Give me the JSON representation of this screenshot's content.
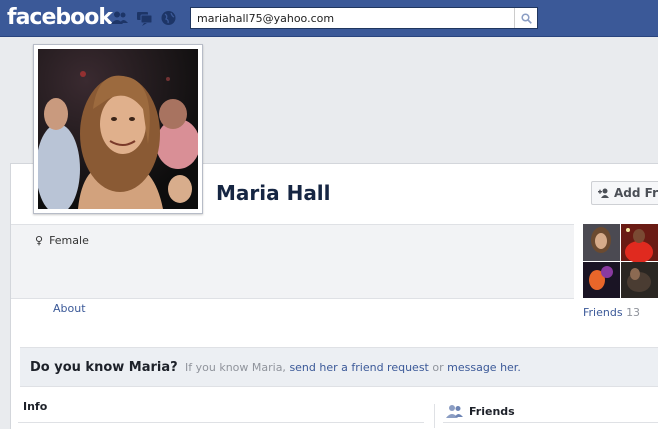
{
  "header": {
    "logo": "facebook",
    "search": {
      "value": "mariahall75@yahoo.com",
      "placeholder": ""
    }
  },
  "profile": {
    "name": "Maria Hall",
    "gender": "Female",
    "add_friend_label": "Add Fr",
    "about_link": "About"
  },
  "friends": {
    "label": "Friends",
    "count": "13"
  },
  "know_banner": {
    "question": "Do you know Maria?",
    "prefix": "If you know Maria,",
    "friend_request_link": "send her a friend request",
    "or": "or",
    "message_link": "message her",
    "period": "."
  },
  "sections": {
    "info": "Info",
    "friends": "Friends"
  },
  "colors": {
    "brand": "#3b5998",
    "link": "#3b5998",
    "name": "#162643"
  }
}
